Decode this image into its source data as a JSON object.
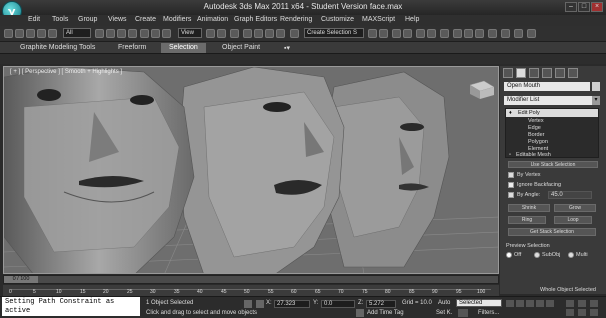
{
  "window": {
    "title": "Autodesk 3ds Max  2011 x64  - Student Version    face.max"
  },
  "menu": [
    "Edit",
    "Tools",
    "Group",
    "Views",
    "Create",
    "Modifiers",
    "Animation",
    "Graph Editors",
    "Rendering",
    "Customize",
    "MAXScript",
    "Help"
  ],
  "toolbar": {
    "filter_value": "All",
    "view_value": "View",
    "named_selection": "Create Selection S"
  },
  "ribbon": {
    "tabs": [
      "Graphite Modeling Tools",
      "Freeform",
      "Selection",
      "Object Paint"
    ],
    "active": "Selection"
  },
  "viewport": {
    "label": "[ + ] [ Perspective ] [ Smooth + Highlights ]"
  },
  "command_panel": {
    "object_name": "Open Mouth",
    "modifier_list": "Modifier List",
    "stack": {
      "top": "Edit Poly",
      "subs": [
        "Vertex",
        "Edge",
        "Border",
        "Polygon",
        "Element"
      ],
      "base": "Editable Mesh"
    },
    "selection": {
      "use_stack": "Use Stack Selection",
      "by_vertex": "By Vertex",
      "ignore_backfacing": "Ignore Backfacing",
      "by_angle": "By Angle:",
      "by_angle_value": "45.0",
      "shrink": "Shrink",
      "grow": "Grow",
      "ring": "Ring",
      "loop": "Loop",
      "get_stack": "Get Stack Selection"
    },
    "preview": {
      "label": "Preview Selection",
      "off": "Off",
      "subobj": "SubObj",
      "multi": "Multi",
      "status": "Whole Object Selected"
    }
  },
  "timeline": {
    "slider": "0 / 100",
    "ticks": [
      "0",
      "5",
      "10",
      "15",
      "20",
      "25",
      "30",
      "35",
      "40",
      "45",
      "50",
      "55",
      "60",
      "65",
      "70",
      "75",
      "80",
      "85",
      "90",
      "95",
      "100"
    ]
  },
  "status": {
    "maxscript": "Setting Path Constraint as active",
    "selected": "1 Object Selected",
    "prompt": "Click and drag to select and move objects",
    "x_label": "X:",
    "x_value": "27.323",
    "y_label": "Y:",
    "y_value": "0.0",
    "z_label": "Z:",
    "z_value": "5.272",
    "grid": "Grid = 10.0",
    "add_time_tag": "Add Time Tag",
    "auto": "Auto",
    "setk": "Set K.",
    "selected_dd": "Selected",
    "filters": "Filters..."
  }
}
